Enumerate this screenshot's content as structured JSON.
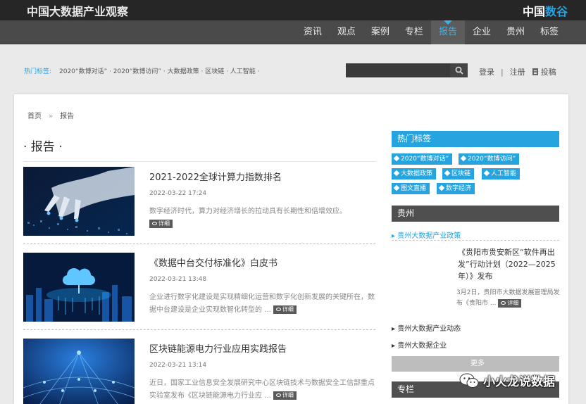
{
  "header": {
    "site_title": "中国大数据产业观察",
    "brand_part1": "中国",
    "brand_part2": "数谷",
    "brand_accent_color": "#25a4e0"
  },
  "nav": {
    "items": [
      "资讯",
      "观点",
      "案例",
      "专栏",
      "报告",
      "企业",
      "贵州",
      "标签"
    ],
    "active": "报告"
  },
  "hot_tags_bar": {
    "label": "热门标签:",
    "links_text": "2020“数博对话” · 2020“数博访问” · 大数据政策 · 区块链 · 人工智能 ·"
  },
  "search": {
    "placeholder": "",
    "icon": "search-icon"
  },
  "account": {
    "login": "登录",
    "separator": "|",
    "register": "注册",
    "submit": "投稿"
  },
  "breadcrumb": {
    "home": "首页",
    "separator": "»",
    "current": "报告"
  },
  "section_title": "· 报告 ·",
  "articles": [
    {
      "title": "2021-2022全球计算力指数排名",
      "date": "2022-03-22 17:24",
      "desc": "数字经济时代，算力对经济增长的拉动具有长期性和倍增效应。",
      "detail": "详细"
    },
    {
      "title": "《数据中台交付标准化》白皮书",
      "date": "2022-03-21 13:48",
      "desc": "企业进行数字化建设是实现精细化运营和数字化创新发展的关键所在，数据中台建设是企业实现数智化转型的 ...",
      "detail": "详细"
    },
    {
      "title": "区块链能源电力行业应用实践报告",
      "date": "2022-03-21 13:14",
      "desc": "近日，国家工业信息安全发展研究中心区块链技术与数据安全工信部重点实验室发布《区块链能源电力行业应 ...",
      "detail": "详细"
    }
  ],
  "sidebar": {
    "hot_tags_title": "热门标签",
    "tags": [
      "2020“数博对话”",
      "2020“数博访问”",
      "大数据政策",
      "区块链",
      "人工智能",
      "图文直播",
      "数字经济"
    ],
    "guizhou_title": "贵州",
    "policy_link": "贵州大数据产业政策",
    "featured_title": "《贵阳市贵安新区“软件再出发”行动计划（2022—2025年）》发布",
    "featured_desc": "3月2日，贵阳市大数据发展管理局发布《贵阳市 ...",
    "featured_detail": "详细",
    "links": [
      "贵州大数据产业动态",
      "贵州大数据企业"
    ],
    "more": "更多",
    "column_title": "专栏"
  },
  "watermark": {
    "text": "小火龙说数据"
  }
}
